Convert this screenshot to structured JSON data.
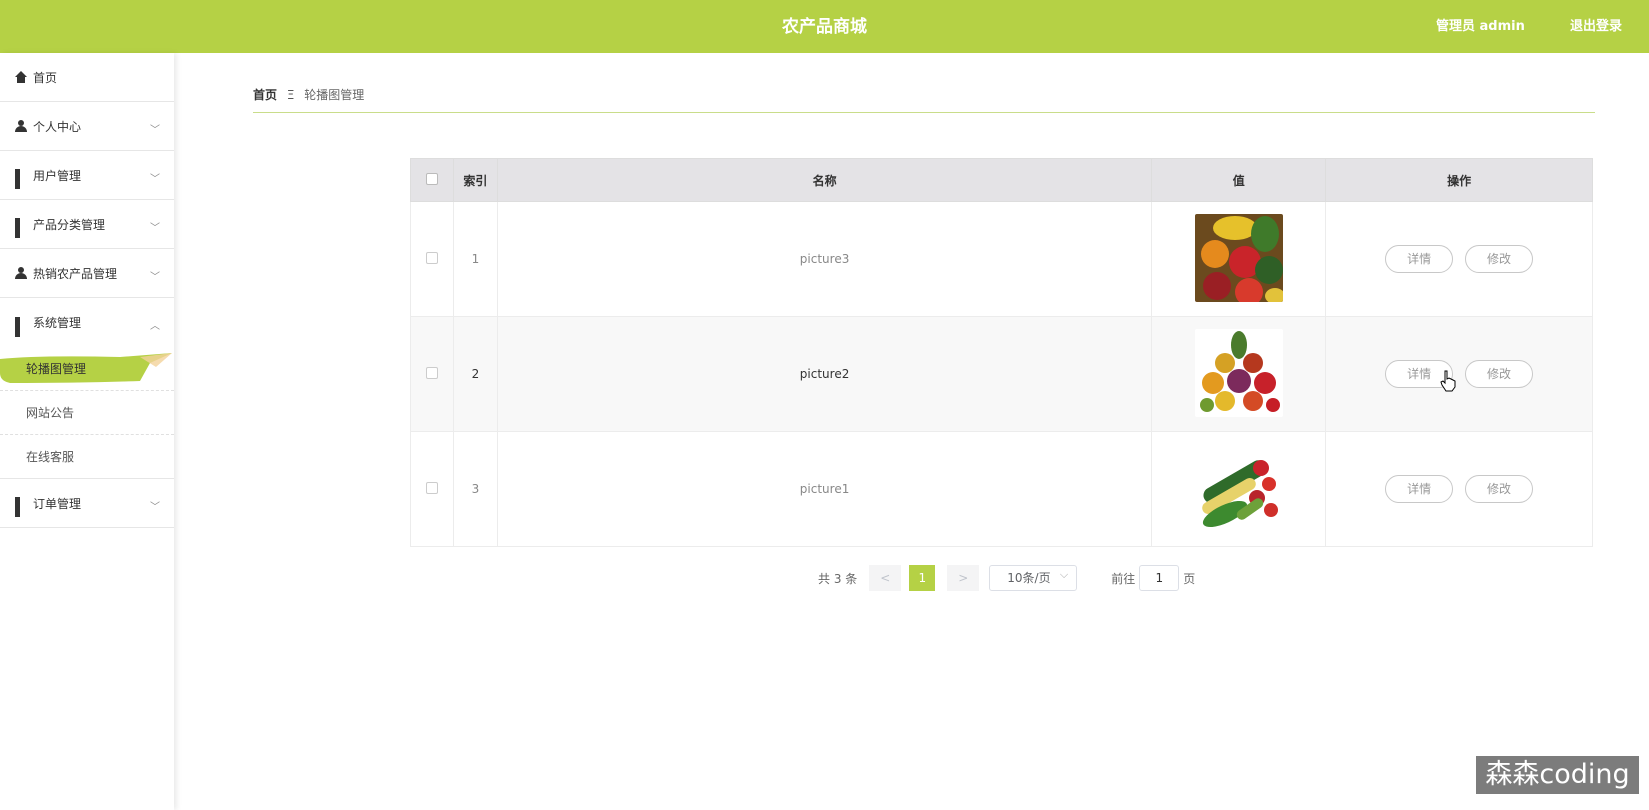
{
  "header": {
    "title": "农产品商城",
    "user": "管理员 admin",
    "logout": "退出登录"
  },
  "sidebar": {
    "items": [
      {
        "label": "首页",
        "icon": "home-icon"
      },
      {
        "label": "个人中心",
        "icon": "person-icon"
      },
      {
        "label": "用户管理",
        "icon": "grid-icon"
      },
      {
        "label": "产品分类管理",
        "icon": "grid-icon"
      },
      {
        "label": "热销农产品管理",
        "icon": "person-icon"
      },
      {
        "label": "系统管理",
        "icon": "grid-icon"
      },
      {
        "label": "订单管理",
        "icon": "grid-icon"
      }
    ],
    "sub_items": [
      {
        "label": "轮播图管理",
        "active": true
      },
      {
        "label": "网站公告"
      },
      {
        "label": "在线客服"
      }
    ]
  },
  "breadcrumb": {
    "home": "首页",
    "separator": "Ξ",
    "current": "轮播图管理"
  },
  "table": {
    "headers": {
      "index": "索引",
      "name": "名称",
      "value": "值",
      "action": "操作"
    },
    "rows": [
      {
        "index": "1",
        "name": "picture3",
        "image": "vegetables-fruits-image"
      },
      {
        "index": "2",
        "name": "picture2",
        "image": "vegetables-fruits-image"
      },
      {
        "index": "3",
        "name": "picture1",
        "image": "vegetables-fruits-image"
      }
    ],
    "detail_label": "详情",
    "edit_label": "修改"
  },
  "pagination": {
    "total": "共 3 条",
    "prev": "<",
    "current_page": "1",
    "next": ">",
    "page_size": "10条/页",
    "goto_prefix": "前往",
    "goto_value": "1",
    "goto_suffix": "页"
  },
  "watermark": "森森coding",
  "colors": {
    "accent": "#b5d145",
    "header_bg": "#e4e3e6"
  }
}
